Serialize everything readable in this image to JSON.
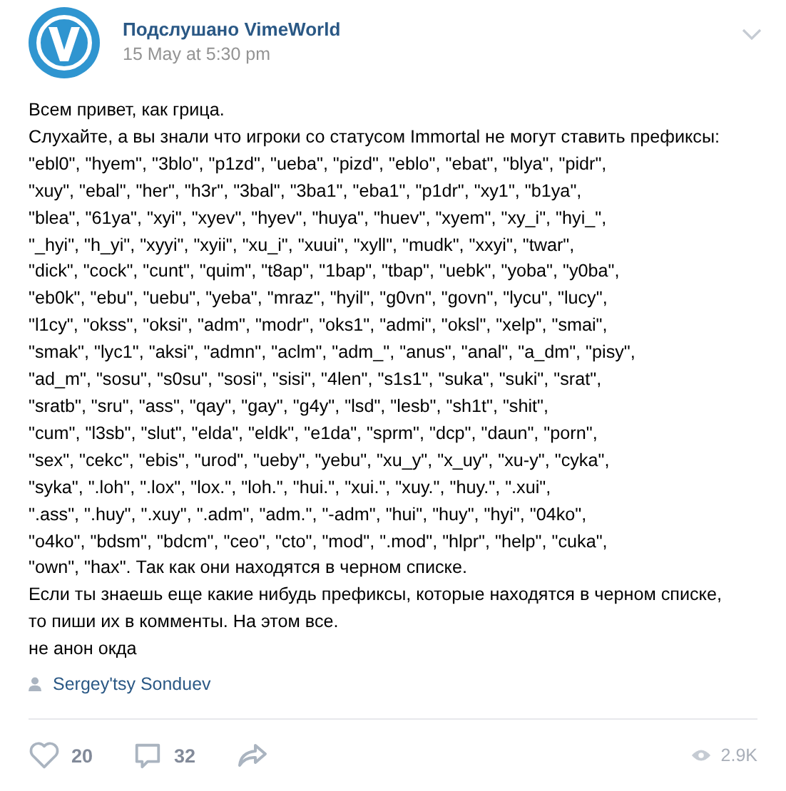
{
  "post": {
    "author": "Подслушано VimeWorld",
    "date": "15 May at 5:30 pm",
    "body_lines": [
      "Всем привет, как грица.",
      "Слухайте, а вы знали что игроки со статусом Immortal не могут ставить префиксы:",
      "\"ebl0\", \"hyem\", \"3blo\", \"p1zd\", \"ueba\", \"pizd\", \"eblo\", \"ebat\", \"blya\", \"pidr\",",
      "\"xuy\", \"ebal\", \"her\", \"h3r\", \"3bal\", \"3ba1\", \"eba1\", \"p1dr\", \"xy1\", \"b1ya\",",
      "\"blea\", \"61ya\", \"xyi\", \"xyev\", \"hyev\", \"huya\", \"huev\", \"xyem\", \"xy_i\", \"hyi_\",",
      "\"_hyi\", \"h_yi\", \"xyyi\", \"xyii\", \"xu_i\", \"xuui\", \"xyll\", \"mudk\", \"xxyi\", \"twar\",",
      "\"dick\", \"cock\", \"cunt\", \"quim\", \"t8ap\", \"1bap\", \"tbap\", \"uebk\", \"yoba\", \"y0ba\",",
      "\"eb0k\", \"ebu\", \"uebu\", \"yeba\", \"mraz\", \"hyil\", \"g0vn\", \"govn\", \"lycu\", \"lucy\",",
      "\"l1cy\", \"okss\", \"oksi\", \"adm\", \"modr\", \"oks1\", \"admi\", \"oksl\", \"xelp\", \"smai\",",
      "\"smak\", \"lyc1\", \"aksi\", \"admn\", \"aclm\", \"adm_\", \"anus\", \"anal\", \"a_dm\", \"pisy\",",
      "\"ad_m\", \"sosu\", \"s0su\", \"sosi\", \"sisi\", \"4len\", \"s1s1\", \"suka\", \"suki\", \"srat\",",
      "\"sratb\", \"sru\", \"ass\", \"qay\", \"gay\", \"g4y\", \"lsd\", \"lesb\", \"sh1t\", \"shit\",",
      "\"cum\", \"l3sb\", \"slut\", \"elda\", \"eldk\", \"e1da\", \"sprm\", \"dcp\", \"daun\", \"porn\",",
      "\"sex\", \"cekc\", \"ebis\", \"urod\", \"ueby\", \"yebu\", \"xu_y\", \"x_uy\", \"xu-y\", \"cyka\",",
      "\"syka\", \".loh\", \".lox\", \"lox.\", \"loh.\", \"hui.\", \"xui.\", \"xuy.\", \"huy.\", \".xui\",",
      "\".ass\", \".huy\", \".xuy\", \".adm\", \"adm.\", \"-adm\", \"hui\", \"huy\", \"hyi\", \"04ko\",",
      "\"o4ko\", \"bdsm\", \"bdcm\", \"ceo\", \"cto\", \"mod\", \".mod\", \"hlpr\", \"help\", \"cuka\",",
      "\"own\", \"hax\". Так как они находятся в черном списке.",
      "Если ты знаешь еще какие нибудь префиксы, которые находятся в черном списке,",
      "то пиши их в комменты. На этом все.",
      "не анон окда"
    ],
    "signer": "Sergey'tsy Sonduev",
    "likes": "20",
    "comments": "32",
    "views": "2.9K"
  }
}
